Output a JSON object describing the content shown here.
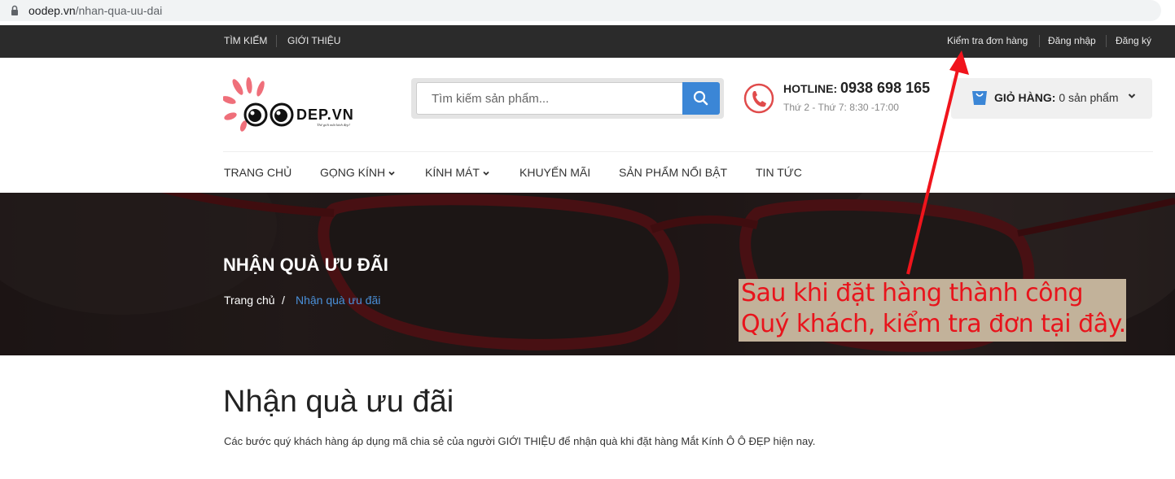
{
  "browser": {
    "url_host": "oodep.vn",
    "url_path": "/nhan-qua-uu-dai"
  },
  "topbar": {
    "left_links": [
      "TÌM KIẾM",
      "GIỚI THIỆU"
    ],
    "right_links": [
      "Kiểm tra đơn hàng",
      "Đăng nhập",
      "Đăng ký"
    ]
  },
  "logo": {
    "text": "DEP.VN",
    "tagline": "Thế giới mắt kính đẹp!"
  },
  "search": {
    "placeholder": "Tìm kiếm sản phẩm..."
  },
  "hotline": {
    "label": "HOTLINE:",
    "number": "0938 698 165",
    "hours": "Thứ 2 - Thứ 7: 8:30 -17:00"
  },
  "cart": {
    "label": "GIỎ HÀNG:",
    "count_text": "0 sản phẩm"
  },
  "nav": [
    "TRANG CHỦ",
    "GỌNG KÍNH",
    "KÍNH MÁT",
    "KHUYẾN MÃI",
    "SẢN PHẨM NỔI BẬT",
    "TIN TỨC"
  ],
  "hero": {
    "title": "NHẬN QUÀ ƯU ĐÃI",
    "breadcrumb": {
      "home": "Trang chủ",
      "separator": "/",
      "current": "Nhận quà ưu đãi"
    }
  },
  "annotation": {
    "line1": "Sau khi đặt hàng thành công",
    "line2": "Quý khách, kiểm tra đơn tại đây."
  },
  "content": {
    "heading": "Nhận quà ưu đãi",
    "description": "Các bước quý khách hàng áp dụng mã chia sẻ của người GIỚI THIỆU để nhận quà khi đặt hàng Mắt Kính Ô Ô ĐẸP hiện nay."
  },
  "colors": {
    "topbar": "#2b2b2b",
    "accent_blue": "#3b86d6",
    "breadcrumb_current": "#4a90d9",
    "annotation_red": "#e8141c",
    "logo_pink": "#ef6f7a"
  }
}
